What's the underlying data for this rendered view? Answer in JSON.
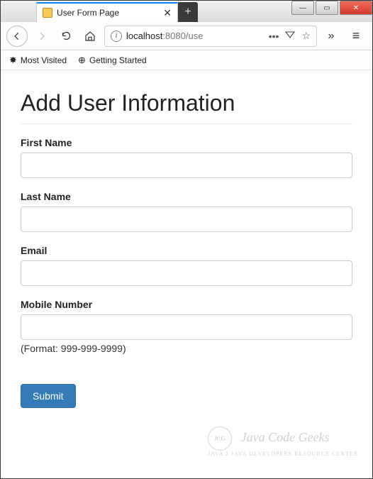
{
  "window": {
    "tab_title": "User Form Page",
    "new_tab_glyph": "+",
    "controls": {
      "min": "—",
      "max": "▭",
      "close": "✕"
    }
  },
  "nav": {
    "url_display_host": "localhost",
    "url_display_port": ":8080",
    "url_display_path": "/use",
    "actions": {
      "more": "•••",
      "pocket": "⌄",
      "star": "☆",
      "overflow": "»",
      "menu": "≡"
    }
  },
  "bookmarks": [
    {
      "icon": "✸",
      "label": "Most Visited"
    },
    {
      "icon": "⊕",
      "label": "Getting Started"
    }
  ],
  "page": {
    "heading": "Add User Information",
    "fields": {
      "first_name": {
        "label": "First Name",
        "value": ""
      },
      "last_name": {
        "label": "Last Name",
        "value": ""
      },
      "email": {
        "label": "Email",
        "value": ""
      },
      "mobile": {
        "label": "Mobile Number",
        "value": "",
        "hint": "(Format: 999-999-9999)"
      }
    },
    "submit_label": "Submit"
  },
  "watermark": {
    "brand": "Java Code Geeks",
    "tagline": "JAVA 2 JAVA DEVELOPERS RESOURCE CENTER"
  }
}
